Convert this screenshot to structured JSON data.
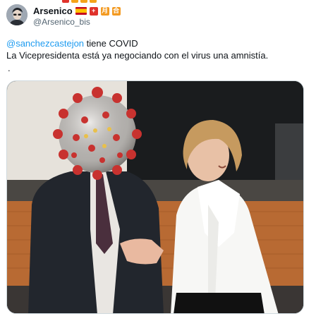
{
  "user": {
    "display_name": "Arsenico",
    "handle": "@Arsenico_bis",
    "badges": [
      "spain-flag",
      "red-plus",
      "orange-moon",
      "orange-square"
    ],
    "emoji_glyphs": [
      "+",
      "月",
      "合"
    ]
  },
  "tweet": {
    "mention": "@sanchezcastejon",
    "line1_rest": " tiene COVID",
    "line2": "La Vicepresidenta está ya negociando con el virus una amnistía.",
    "dot": "."
  },
  "media": {
    "type": "photo",
    "description_icon": "photo-icon"
  },
  "colors": {
    "link": "#1d9bf0",
    "text": "#0f1419",
    "secondary": "#536471",
    "border": "#cfd9de"
  }
}
